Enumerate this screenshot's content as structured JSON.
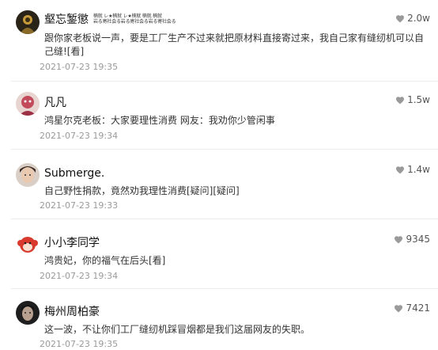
{
  "comments": [
    {
      "username": "壑忘錾懲",
      "username_decor": "楠就 レ★楠就 レ★楠就 楠就 楠就 楠就\n岩る寄社会る岩る寄社会る岩る寄社会る岩る寄社会る",
      "likes": "2.0w",
      "text": "跟你家老板说一声，要是工厂生产不过来就把原材料直接寄过来，我自己家有缝纫机可以自己缝![看]",
      "time": "2021-07-23 19:35",
      "avatar": "dark-figure"
    },
    {
      "username": "凡凡",
      "likes": "1.5w",
      "text": "鸿星尔克老板：大家要理性消费 网友：我劝你少管闲事",
      "time": "2021-07-23 19:34",
      "avatar": "pink-figure"
    },
    {
      "username": "Submerge.",
      "likes": "1.4w",
      "text": "自己野性捐款，竟然劝我理性消费[疑问][疑问]",
      "time": "2021-07-23 19:33",
      "avatar": "photo-face"
    },
    {
      "username": "小小李同学",
      "likes": "9345",
      "text": "鸿贵妃，你的福气在后头[看]",
      "time": "2021-07-23 19:34",
      "avatar": "red-monkey"
    },
    {
      "username": "梅州周柏豪",
      "likes": "7421",
      "text": "这一波，不让你们工厂缝纫机踩冒烟都是我们这届网友的失职。",
      "time": "2021-07-23 19:35",
      "avatar": "dark-face"
    }
  ],
  "colors": {
    "time": "#9a9a9a",
    "like": "#555555",
    "divider": "#ececec"
  }
}
